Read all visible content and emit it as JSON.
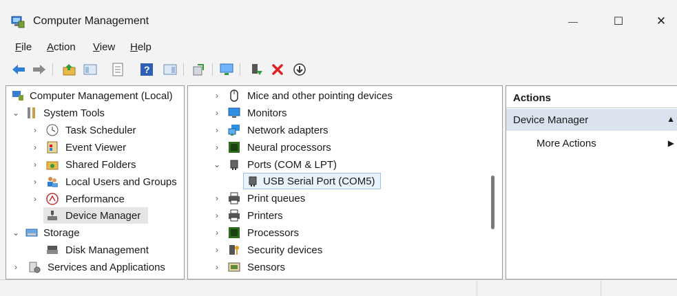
{
  "window": {
    "title": "Computer Management",
    "minimize_glyph": "—",
    "maximize_glyph": "☐",
    "close_glyph": "✕"
  },
  "menu": {
    "items": [
      {
        "label": "File",
        "accel": "F",
        "rest": "ile"
      },
      {
        "label": "Action",
        "accel": "A",
        "rest": "ction"
      },
      {
        "label": "View",
        "accel": "V",
        "rest": "iew"
      },
      {
        "label": "Help",
        "accel": "H",
        "rest": "elp"
      }
    ]
  },
  "toolbar": {
    "icons": [
      "back-arrow-icon",
      "forward-arrow-icon",
      "up-folder-icon",
      "show-hide-tree-icon",
      "properties-icon",
      "help-icon",
      "show-action-pane-icon",
      "export-icon",
      "computer-monitor-icon",
      "enable-device-icon",
      "uninstall-x-icon",
      "update-driver-down-icon"
    ]
  },
  "tree": {
    "root": "Computer Management (Local)",
    "system_tools": "System Tools",
    "task_scheduler": "Task Scheduler",
    "event_viewer": "Event Viewer",
    "shared_folders": "Shared Folders",
    "local_users": "Local Users and Groups",
    "performance": "Performance",
    "device_manager": "Device Manager",
    "storage": "Storage",
    "disk_management": "Disk Management",
    "services": "Services and Applications"
  },
  "devices": {
    "mice": "Mice and other pointing devices",
    "monitors": "Monitors",
    "network": "Network adapters",
    "neural": "Neural processors",
    "ports": "Ports (COM & LPT)",
    "usb_serial": "USB Serial Port (COM5)",
    "print_queues": "Print queues",
    "printers": "Printers",
    "processors": "Processors",
    "security": "Security devices",
    "sensors": "Sensors"
  },
  "actions": {
    "header": "Actions",
    "section": "Device Manager",
    "more": "More Actions"
  },
  "colors": {
    "accent_blue": "#2f7fd6",
    "selection_gray": "#e5e5e5",
    "action_section": "#dbe4ee",
    "red_x": "#e02020",
    "green": "#2e9d3a"
  }
}
